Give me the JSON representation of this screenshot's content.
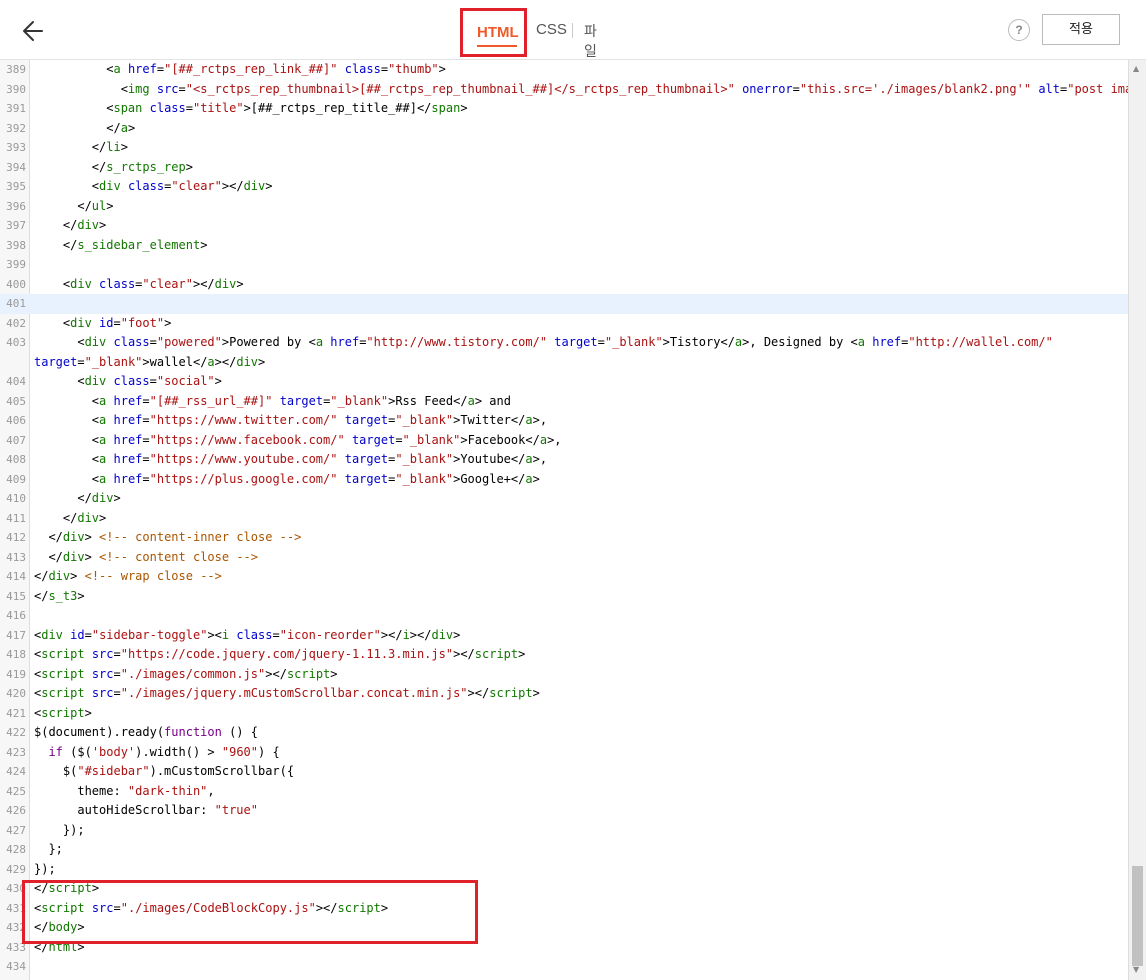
{
  "header": {
    "tabs": {
      "html": "HTML",
      "css": "CSS",
      "upload": "파일업로드"
    },
    "help_label": "?",
    "apply_label": "적용",
    "icons": {
      "back": "arrow-left-icon",
      "help": "question-icon"
    },
    "accent_color": "#f05a2a",
    "highlight_color": "#e0202a"
  },
  "editor": {
    "active_line": "401",
    "line_numbers": [
      "389",
      "390",
      "391",
      "392",
      "393",
      "394",
      "395",
      "396",
      "397",
      "398",
      "399",
      "400",
      "401",
      "402",
      "403",
      "404",
      "405",
      "406",
      "407",
      "408",
      "409",
      "410",
      "411",
      "412",
      "413",
      "414",
      "415",
      "416",
      "417",
      "418",
      "419",
      "420",
      "421",
      "422",
      "423",
      "424",
      "425",
      "426",
      "427",
      "428",
      "429",
      "430",
      "431",
      "432",
      "433",
      "434"
    ]
  }
}
